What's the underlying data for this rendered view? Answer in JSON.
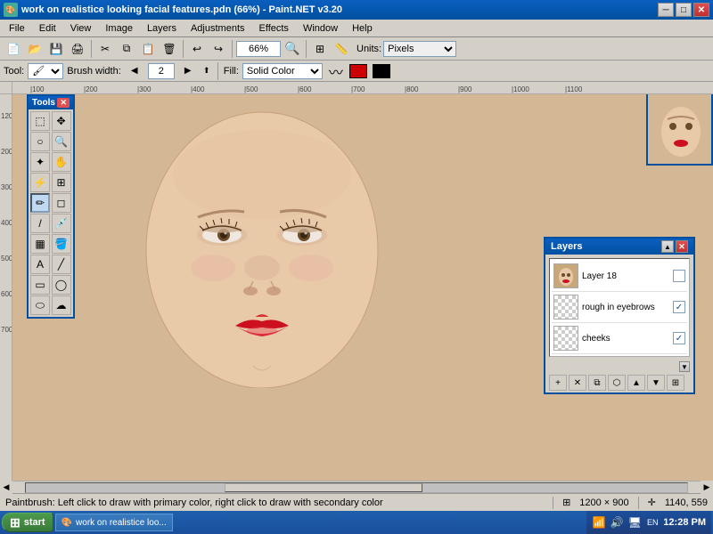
{
  "titlebar": {
    "title": "work on realistice looking facial features.pdn (66%) - Paint.NET v3.20",
    "icon": "🎨",
    "min_label": "─",
    "max_label": "□",
    "close_label": "✕"
  },
  "menubar": {
    "items": [
      "File",
      "Edit",
      "View",
      "Image",
      "Layers",
      "Adjustments",
      "Effects",
      "Window",
      "Help"
    ]
  },
  "toolbar1": {
    "zoom_value": "66%",
    "units_label": "Units:",
    "units_value": "Pixels"
  },
  "toolbar2": {
    "tool_label": "Tool:",
    "brush_width_label": "Brush width:",
    "brush_width_value": "2",
    "fill_label": "Fill:",
    "fill_value": "Solid Color"
  },
  "tools_panel": {
    "title": "Tools",
    "close_label": "✕",
    "tools": [
      {
        "name": "rectangle-select",
        "icon": "⬚"
      },
      {
        "name": "move",
        "icon": "✥"
      },
      {
        "name": "lasso",
        "icon": "⭕"
      },
      {
        "name": "zoom",
        "icon": "🔍"
      },
      {
        "name": "magic-wand",
        "icon": "✦"
      },
      {
        "name": "hand",
        "icon": "✋"
      },
      {
        "name": "recolor",
        "icon": "⚡"
      },
      {
        "name": "clone",
        "icon": "⊞"
      },
      {
        "name": "paintbrush",
        "icon": "✏"
      },
      {
        "name": "eraser",
        "icon": "◻"
      },
      {
        "name": "pencil",
        "icon": "/"
      },
      {
        "name": "color-picker",
        "icon": "💉"
      },
      {
        "name": "gradient",
        "icon": "▦"
      },
      {
        "name": "paint-bucket",
        "icon": "🪣"
      },
      {
        "name": "text",
        "icon": "A"
      },
      {
        "name": "line",
        "icon": "╱"
      },
      {
        "name": "rectangle",
        "icon": "▭"
      },
      {
        "name": "ellipse-round",
        "icon": "◯"
      },
      {
        "name": "ellipse",
        "icon": "⬭"
      },
      {
        "name": "cloud",
        "icon": "☁"
      }
    ]
  },
  "layers_panel": {
    "title": "Layers",
    "close_label": "✕",
    "layers": [
      {
        "name": "Layer 18",
        "has_check": true,
        "checked": false,
        "thumb_type": "face"
      },
      {
        "name": "rough in eyebrows",
        "has_check": true,
        "checked": true,
        "thumb_type": "checker"
      },
      {
        "name": "cheeks",
        "has_check": true,
        "checked": true,
        "thumb_type": "checker"
      }
    ],
    "toolbar_buttons": [
      "+",
      "✕",
      "⧉",
      "⬡",
      "▲",
      "▼",
      "⊞"
    ]
  },
  "statusbar": {
    "message": "Paintbrush: Left click to draw with primary color, right click to draw with secondary color",
    "dimensions": "1200 × 900",
    "coordinates": "1140, 559"
  },
  "taskbar": {
    "start_label": "start",
    "window_item": "work on realistice loo...",
    "time": "12:28 PM",
    "sys_icons": [
      "🔊",
      "🖥",
      "📶"
    ]
  },
  "colors": {
    "titlebar_bg": "#0a5fbf",
    "bg": "#d4d0c8",
    "canvas_bg": "#d4b896",
    "accent": "#0050a0"
  }
}
